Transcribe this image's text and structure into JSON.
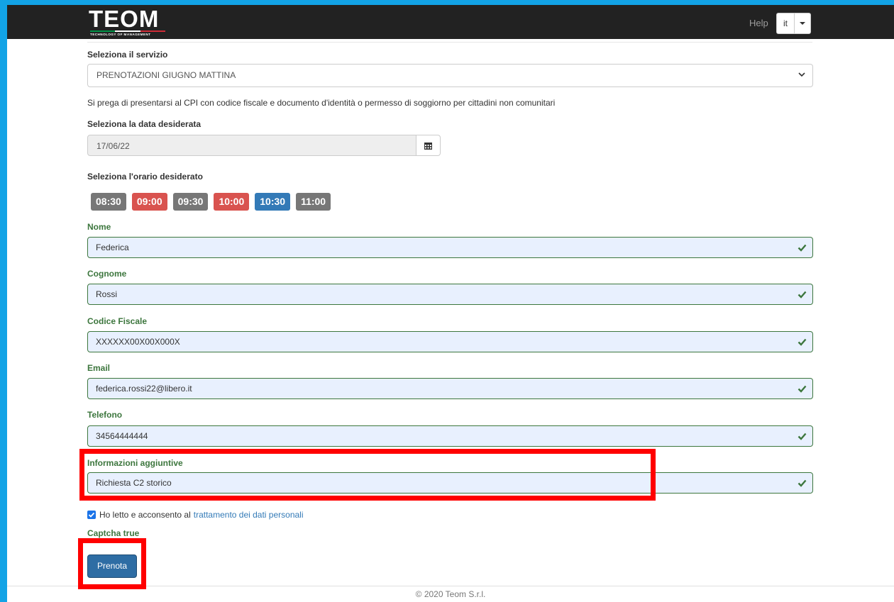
{
  "header": {
    "logo_text": "TEOM",
    "logo_tagline": "TECHNOLOGY OF MANAGEMENT",
    "help_label": "Help",
    "language": "it"
  },
  "form": {
    "service": {
      "label": "Seleziona il servizio",
      "value": "PRENOTAZIONI GIUGNO MATTINA"
    },
    "note": "Si prega di presentarsi al CPI con codice fiscale e documento d'identità o permesso di soggiorno per cittadini non comunitari",
    "date": {
      "label": "Seleziona la data desiderata",
      "value": "17/06/22"
    },
    "time": {
      "label": "Seleziona l'orario desiderato",
      "slots": [
        {
          "label": "08:30",
          "color": "#777777"
        },
        {
          "label": "09:00",
          "color": "#d9534f"
        },
        {
          "label": "09:30",
          "color": "#777777"
        },
        {
          "label": "10:00",
          "color": "#d9534f"
        },
        {
          "label": "10:30",
          "color": "#337ab7"
        },
        {
          "label": "11:00",
          "color": "#777777"
        }
      ]
    },
    "nome": {
      "label": "Nome",
      "value": "Federica"
    },
    "cognome": {
      "label": "Cognome",
      "value": "Rossi"
    },
    "codice_fiscale": {
      "label": "Codice Fiscale",
      "value": "XXXXXX00X00X000X"
    },
    "email": {
      "label": "Email",
      "value": "federica.rossi22@libero.it"
    },
    "telefono": {
      "label": "Telefono",
      "value": "34564444444"
    },
    "informazioni": {
      "label": "Informazioni aggiuntive",
      "value": "Richiesta C2 storico"
    },
    "consent": {
      "text": "Ho letto e acconsento al",
      "link": "trattamento dei dati personali",
      "checked": true
    },
    "captcha": "Captcha true",
    "submit_label": "Prenota"
  },
  "footer": {
    "text": "© 2020 Teom S.r.l."
  },
  "colors": {
    "success": "#3c763d",
    "primary": "#2e6da4",
    "highlight": "#ff0000",
    "screen_border": "#12a3e6"
  }
}
